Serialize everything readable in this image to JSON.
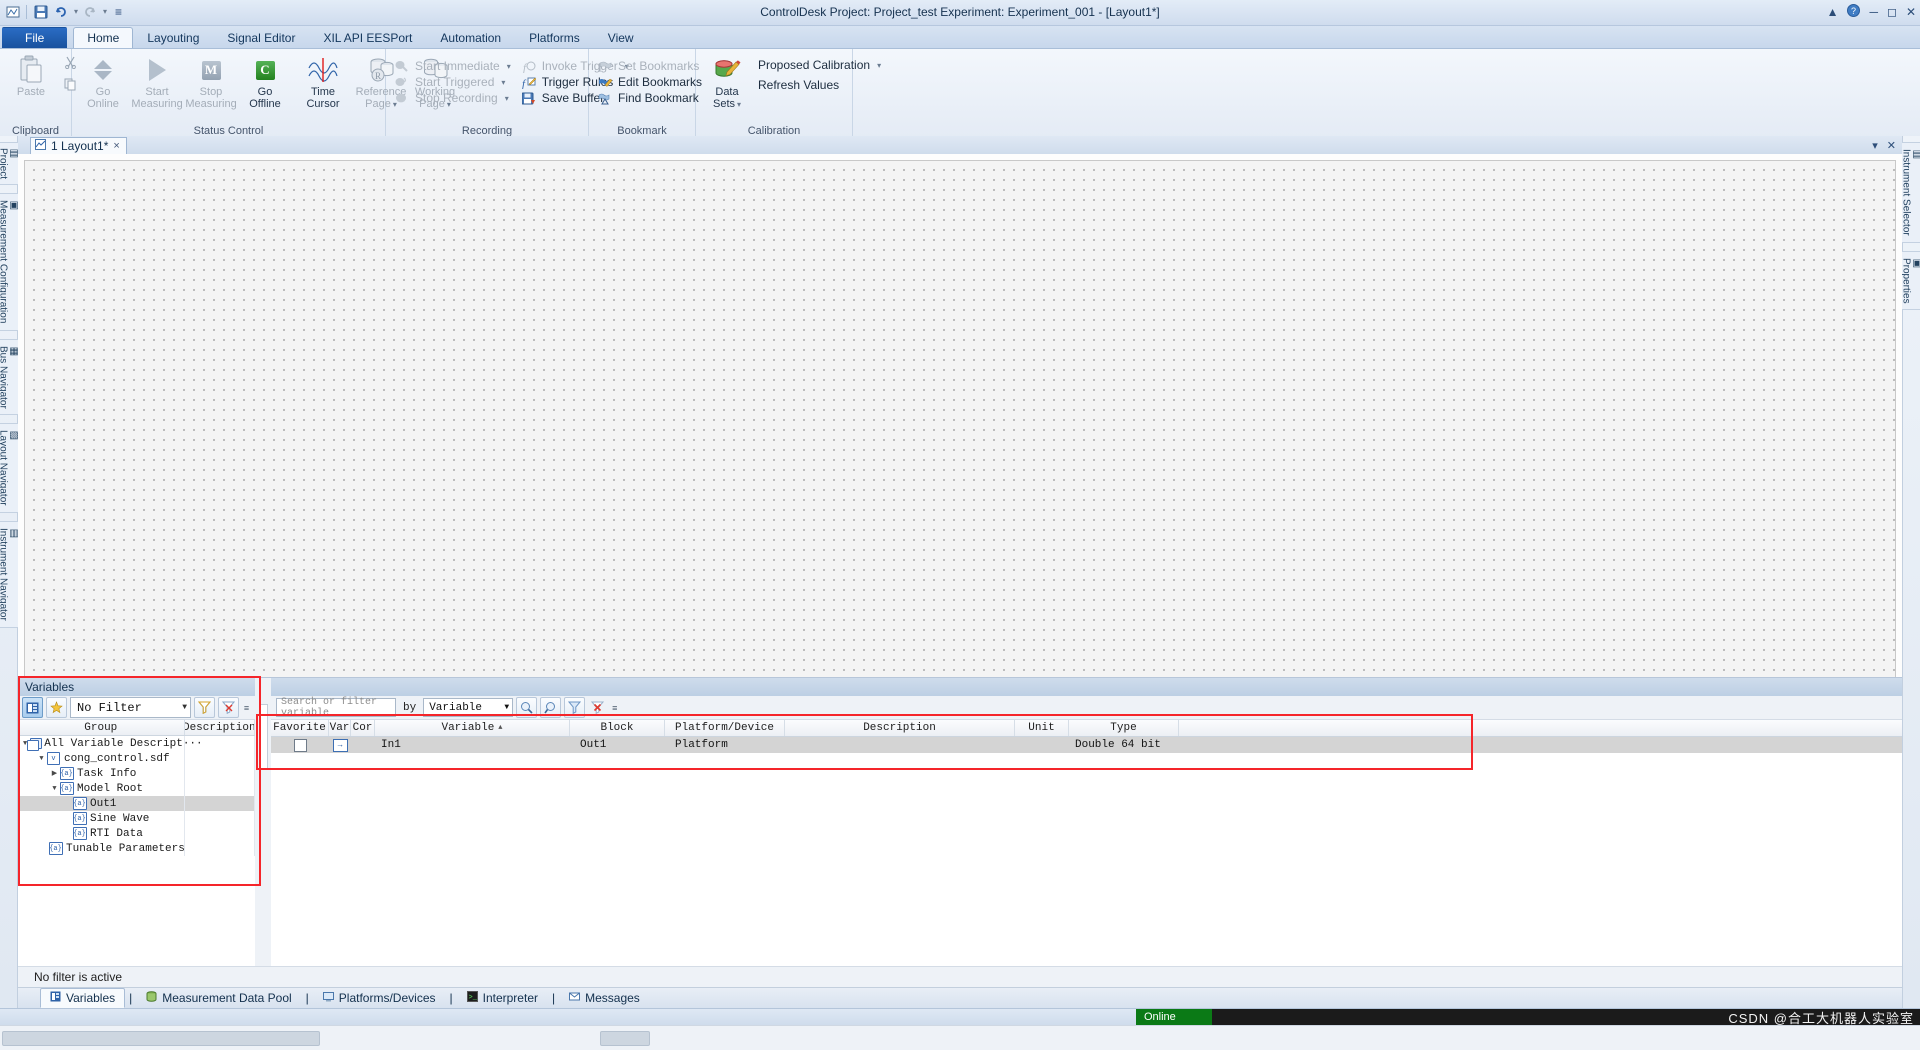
{
  "window": {
    "title": "ControlDesk  Project: Project_test  Experiment: Experiment_001 - [Layout1*]",
    "quick_access": [
      "app-icon",
      "save-icon",
      "undo-icon",
      "redo-icon",
      "customize-icon"
    ],
    "buttons": [
      "help-icon",
      "minimize",
      "maximize",
      "close"
    ]
  },
  "ribbon": {
    "tabs": [
      {
        "label": "File",
        "type": "file"
      },
      {
        "label": "Home",
        "type": "active"
      },
      {
        "label": "Layouting",
        "type": "normal"
      },
      {
        "label": "Signal Editor",
        "type": "normal"
      },
      {
        "label": "XIL API EESPort",
        "type": "normal"
      },
      {
        "label": "Automation",
        "type": "normal"
      },
      {
        "label": "Platforms",
        "type": "normal"
      },
      {
        "label": "View",
        "type": "normal"
      }
    ],
    "groups": [
      {
        "caption": "Clipboard",
        "big": [
          {
            "label1": "Paste",
            "label2": "",
            "icon": "paste-icon",
            "disabled": true
          }
        ],
        "small": [
          {
            "label": "",
            "icon": "cut-icon",
            "disabled": true
          },
          {
            "label": "",
            "icon": "copy-icon",
            "disabled": true
          }
        ]
      },
      {
        "caption": "Status Control",
        "big": [
          {
            "label1": "Go",
            "label2": "Online",
            "icon": "go-online-icon",
            "disabled": true
          },
          {
            "label1": "Start",
            "label2": "Measuring",
            "icon": "start-measuring-icon",
            "disabled": true
          },
          {
            "label1": "Stop",
            "label2": "Measuring",
            "icon": "stop-measuring-icon",
            "disabled": true
          },
          {
            "label1": "Go",
            "label2": "Offline",
            "icon": "go-offline-icon",
            "disabled": false
          },
          {
            "label1": "Time",
            "label2": "Cursor",
            "icon": "time-cursor-icon",
            "disabled": false
          },
          {
            "label1": "Reference",
            "label2": "Page",
            "icon": "reference-page-icon",
            "disabled": true
          },
          {
            "label1": "Working",
            "label2": "Page",
            "icon": "working-page-icon",
            "disabled": true
          }
        ]
      },
      {
        "caption": "Recording",
        "col1": [
          {
            "label": "Start Immediate",
            "icon": "start-immediate-icon",
            "disabled": true,
            "caret": true
          },
          {
            "label": "Start Triggered",
            "icon": "start-triggered-icon",
            "disabled": true,
            "caret": true
          },
          {
            "label": "Stop Recording",
            "icon": "stop-recording-icon",
            "disabled": true,
            "caret": true
          }
        ],
        "col2": [
          {
            "label": "Invoke Trigger",
            "icon": "invoke-trigger-icon",
            "disabled": true,
            "caret": true
          },
          {
            "label": "Trigger Rules",
            "icon": "trigger-rules-icon",
            "disabled": false,
            "caret": false
          },
          {
            "label": "Save Buffer",
            "icon": "save-buffer-icon",
            "disabled": false,
            "caret": false
          }
        ]
      },
      {
        "caption": "Bookmark",
        "col1": [
          {
            "label": "Set Bookmarks",
            "icon": "set-bookmarks-icon",
            "disabled": true,
            "caret": false
          },
          {
            "label": "Edit Bookmarks",
            "icon": "edit-bookmarks-icon",
            "disabled": false,
            "caret": false
          },
          {
            "label": "Find Bookmark",
            "icon": "find-bookmark-icon",
            "disabled": false,
            "caret": false
          }
        ]
      },
      {
        "caption": "Calibration",
        "big": [
          {
            "label1": "Data",
            "label2": "Sets",
            "icon": "data-sets-icon",
            "disabled": false
          }
        ],
        "col1": [
          {
            "label": "Proposed Calibration",
            "icon": "proposed-calibration-icon",
            "disabled": false,
            "caret": true
          },
          {
            "label": "Refresh Values",
            "icon": "refresh-values-icon",
            "disabled": false,
            "caret": false
          }
        ]
      }
    ]
  },
  "left_rail": [
    {
      "label": "Project",
      "icon": "project-icon"
    },
    {
      "label": "Measurement Configuration",
      "icon": "measurement-config-icon"
    },
    {
      "label": "Bus Navigator",
      "icon": "bus-navigator-icon"
    },
    {
      "label": "Layout Navigator",
      "icon": "layout-navigator-icon"
    },
    {
      "label": "Instrument Navigator",
      "icon": "instrument-navigator-icon"
    }
  ],
  "right_rail": [
    {
      "label": "Instrument Selector",
      "icon": "instrument-selector-icon"
    },
    {
      "label": "Properties",
      "icon": "properties-icon"
    }
  ],
  "document": {
    "tab_label": "1 Layout1*",
    "tab_icon": "layout-icon",
    "close_glyph": "×",
    "pin_glyph": "▾",
    "close_panel_glyph": "✕"
  },
  "variables_panel": {
    "title": "Variables",
    "toolbar": {
      "list_view_icon": "list-view-icon",
      "favorites_icon": "favorites-star-icon",
      "filter_value": "No Filter",
      "apply_filter_icon": "apply-filter-icon",
      "clear_filter_icon": "clear-filter-icon",
      "overflow_icon": "overflow-icon"
    },
    "columns": [
      "Group",
      "Description"
    ],
    "tree": [
      {
        "label": "All Variable Descript···",
        "indent": 0,
        "expander": "expanded",
        "icon": "variable-description-set-icon",
        "selected": false
      },
      {
        "label": "cong_control.sdf",
        "indent": 1,
        "expander": "expanded",
        "icon": "sdf-file-icon",
        "selected": false
      },
      {
        "label": "Task Info",
        "indent": 2,
        "expander": "collapsed",
        "icon": "group-icon",
        "selected": false
      },
      {
        "label": "Model Root",
        "indent": 2,
        "expander": "expanded",
        "icon": "group-icon",
        "selected": false
      },
      {
        "label": "Out1",
        "indent": 3,
        "expander": "none",
        "icon": "variable-icon",
        "selected": true
      },
      {
        "label": "Sine Wave",
        "indent": 3,
        "expander": "none",
        "icon": "variable-icon",
        "selected": false
      },
      {
        "label": "RTI Data",
        "indent": 3,
        "expander": "none",
        "icon": "variable-icon",
        "selected": false
      },
      {
        "label": "Tunable Parameters",
        "indent": 2,
        "expander": "none",
        "icon": "group-icon",
        "selected": false
      }
    ]
  },
  "variables_table": {
    "search": {
      "placeholder": "Search or filter variable",
      "by_label": "by",
      "by_value": "Variable",
      "find_icon": "find-icon",
      "find-next_icon": "find-next-icon",
      "filter_icon": "filter-icon",
      "clear_icon": "clear-filter-icon",
      "overflow_icon": "overflow-icon"
    },
    "columns": [
      "Favorite",
      "Var",
      "Cor",
      "Variable",
      "Block",
      "Platform/Device",
      "Description",
      "Unit",
      "Type"
    ],
    "sort_column": "Variable",
    "sort_direction": "asc",
    "rows": [
      {
        "favorite": "",
        "var": "",
        "cor": "",
        "variable": "In1",
        "block": "Out1",
        "platform_device": "Platform",
        "description": "",
        "unit": "",
        "type": "Double 64 bit"
      }
    ]
  },
  "filter_status": "No filter is active",
  "bottom_tabs": [
    {
      "label": "Variables",
      "icon": "variables-icon",
      "active": true
    },
    {
      "label": "Measurement Data Pool",
      "icon": "data-pool-icon",
      "active": false
    },
    {
      "label": "Platforms/Devices",
      "icon": "platforms-icon",
      "active": false
    },
    {
      "label": "Interpreter",
      "icon": "interpreter-icon",
      "active": false
    },
    {
      "label": "Messages",
      "icon": "messages-icon",
      "active": false
    }
  ],
  "status_bar": {
    "online_label": "Online",
    "online_color": "#0b7a16",
    "watermark": "CSDN @合工大机器人实验室"
  }
}
